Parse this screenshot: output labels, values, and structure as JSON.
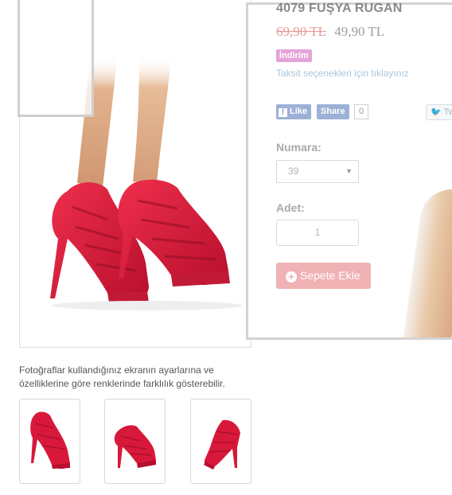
{
  "product": {
    "title": "4079 FUŞYA RUGAN",
    "old_price": "69,90 TL",
    "new_price": "49,90 TL",
    "badge": "İndirim",
    "installments_link": "Taksit seçenekleri için tıklayınız"
  },
  "social": {
    "fb_like": "Like",
    "fb_share": "Share",
    "fb_count": "0",
    "tweet": "Tw"
  },
  "options": {
    "size_label": "Numara:",
    "size_value": "39",
    "qty_label": "Adet:",
    "qty_value": "1",
    "add_to_cart": "Sepete Ekle"
  },
  "gallery": {
    "disclaimer": "Fotoğraflar kullandığınız ekranın ayarlarına ve özelliklerine göre renklerinde farklılık gösterebilir.",
    "thumbnails": [
      "shoe-front-view",
      "shoe-side-view",
      "shoe-back-view"
    ]
  },
  "colors": {
    "shoe_red": "#d8183a",
    "cart_button": "#f0b2b4",
    "badge": "#e6a3d8",
    "old_price": "#d9534f"
  }
}
